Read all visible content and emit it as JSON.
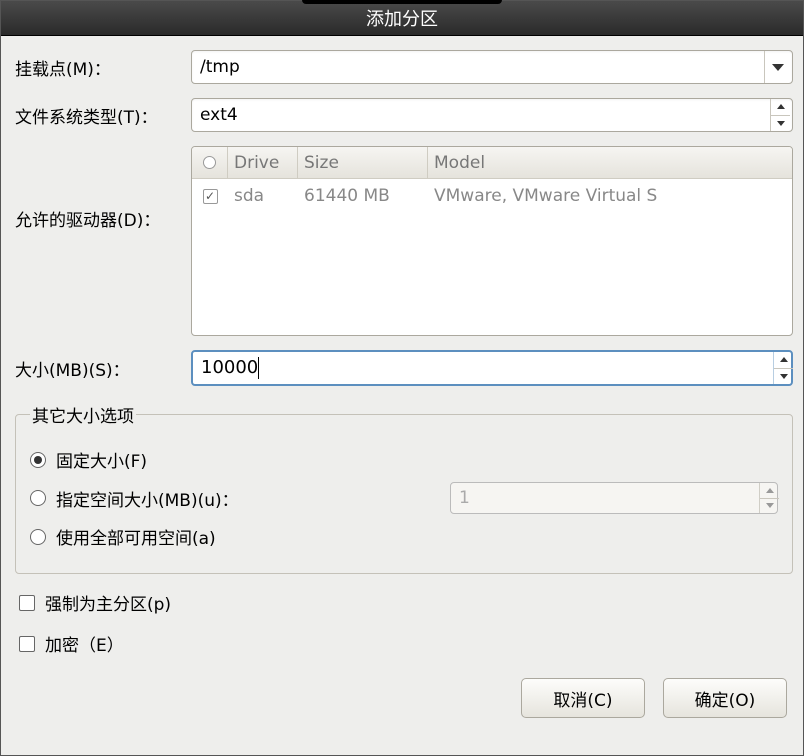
{
  "title": "添加分区",
  "fields": {
    "mount_point": {
      "label": "挂载点(M)：",
      "value": "/tmp"
    },
    "fs_type": {
      "label": "文件系统类型(T)：",
      "value": "ext4"
    },
    "drives": {
      "label": "允许的驱动器(D)：",
      "headers": {
        "drive": "Drive",
        "size": "Size",
        "model": "Model"
      },
      "rows": [
        {
          "checked": true,
          "drive": "sda",
          "size": "61440 MB",
          "model": "VMware, VMware Virtual S"
        }
      ]
    },
    "size": {
      "label": "大小(MB)(S)：",
      "value": "10000"
    }
  },
  "size_options": {
    "legend": "其它大小选项",
    "fixed": "固定大小(F)",
    "specify": "指定空间大小(MB)(u)：",
    "specify_value": "1",
    "all": "使用全部可用空间(a)",
    "selected": "fixed"
  },
  "checkboxes": {
    "primary": "强制为主分区(p)",
    "encrypt": "加密（E）"
  },
  "buttons": {
    "cancel": "取消(C)",
    "ok": "确定(O)"
  }
}
